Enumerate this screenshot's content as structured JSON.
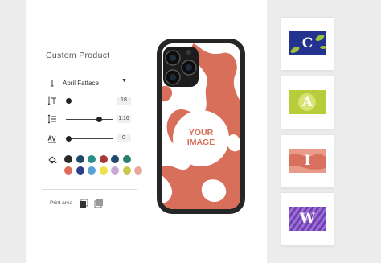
{
  "panel": {
    "title": "Custom Product",
    "font": {
      "name": "Abril Fatface"
    },
    "size": {
      "value": "18",
      "level": 0.0
    },
    "line_height": {
      "value": "1.16",
      "level": 0.7
    },
    "letter_spacing": {
      "value": "0",
      "level": 0.0
    },
    "colors": [
      "#2a2a2a",
      "#1e4a6e",
      "#2b8e8a",
      "#a83838",
      "#1e4a6e",
      "#2a7f6e",
      "#e0695a",
      "#2b3e8c",
      "#5aa0d8",
      "#efe14a",
      "#c9a8d8",
      "#c8c84a",
      "#e8a898"
    ],
    "print_area_label": "Print area"
  },
  "phone": {
    "case_color": "#d86f5b",
    "placeholder_line1": "YOUR",
    "placeholder_line2": "IMAGE"
  },
  "thumbnails": [
    {
      "letter": "C",
      "bg": "#23318f",
      "accent": "#9fc13a"
    },
    {
      "letter": "A",
      "bg": "#b7cd3b",
      "accent": "#d7e270"
    },
    {
      "letter": "I",
      "bg": "#d9705d",
      "accent": "#e89a8b"
    },
    {
      "letter": "W",
      "bg": "#6f3fb0",
      "accent": "#9c6fd6"
    }
  ]
}
